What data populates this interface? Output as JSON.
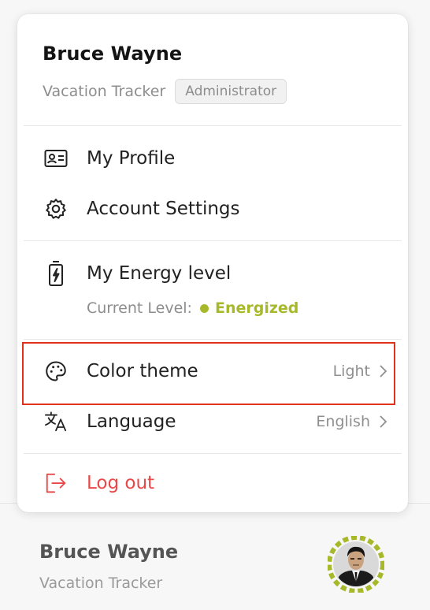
{
  "menu": {
    "user_name": "Bruce Wayne",
    "company": "Vacation Tracker",
    "role": "Administrator",
    "items": {
      "profile": {
        "label": "My Profile",
        "icon": "id-card-icon"
      },
      "settings": {
        "label": "Account Settings",
        "icon": "gear-icon"
      },
      "energy": {
        "label": "My Energy level",
        "icon": "battery-icon",
        "current_label": "Current Level:",
        "current_value": "Energized",
        "status_color": "#a7b92a"
      },
      "theme": {
        "label": "Color theme",
        "value": "Light",
        "icon": "palette-icon"
      },
      "language": {
        "label": "Language",
        "value": "English",
        "icon": "translate-icon"
      },
      "logout": {
        "label": "Log out",
        "icon": "logout-icon",
        "color": "#ea4848"
      }
    }
  },
  "footer": {
    "user_name": "Bruce Wayne",
    "company": "Vacation Tracker"
  },
  "colors": {
    "accent_green": "#a7b92a",
    "danger": "#ea4848",
    "highlight_border": "#e0311b"
  }
}
